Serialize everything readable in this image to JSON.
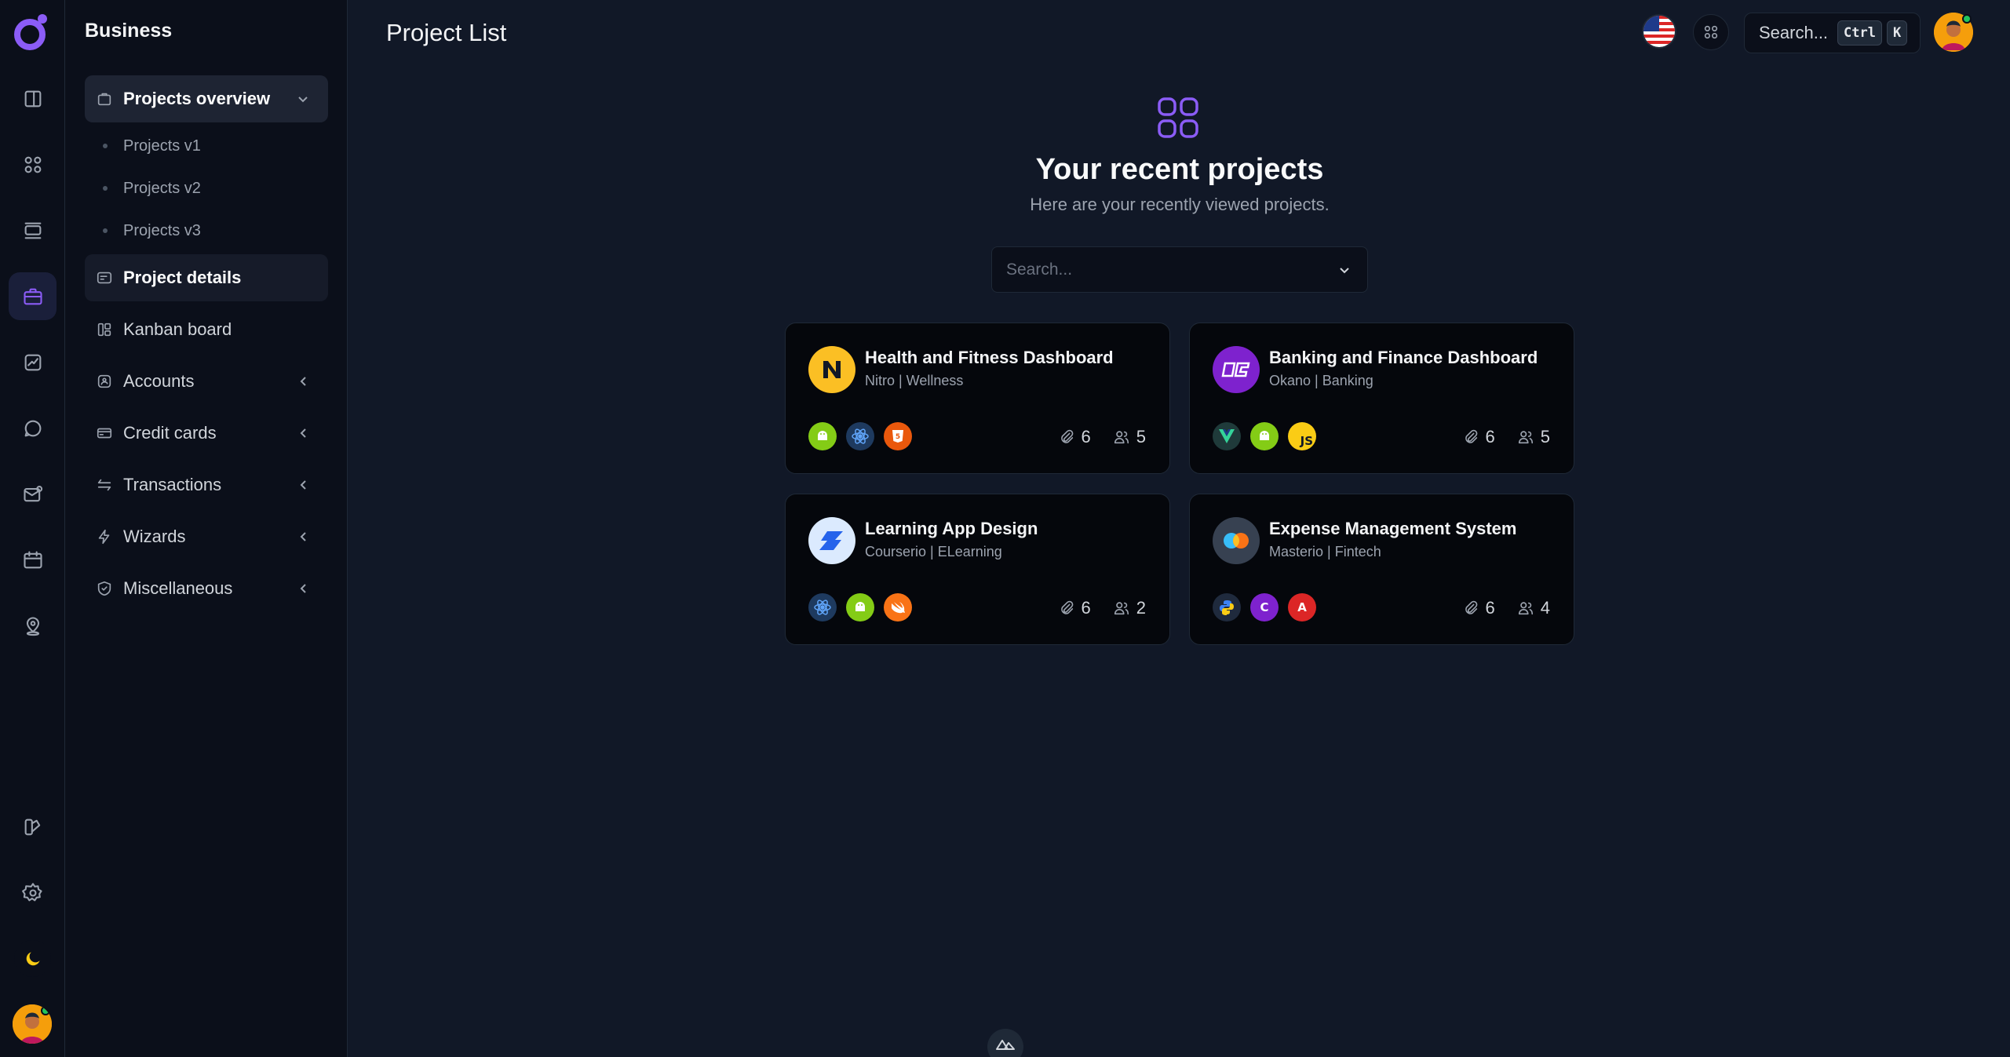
{
  "sidebar": {
    "brand": "Business",
    "items": [
      {
        "label": "Projects overview",
        "icon": "briefcase-bag-icon",
        "state": "open"
      },
      {
        "label": "Project details",
        "icon": "card-icon",
        "state": "active"
      },
      {
        "label": "Kanban board",
        "icon": "kanban-icon"
      },
      {
        "label": "Accounts",
        "icon": "accounts-icon"
      },
      {
        "label": "Credit cards",
        "icon": "credit-card-icon"
      },
      {
        "label": "Transactions",
        "icon": "arrows-icon"
      },
      {
        "label": "Wizards",
        "icon": "bolt-icon"
      },
      {
        "label": "Miscellaneous",
        "icon": "shield-icon"
      }
    ],
    "subitems": [
      "Projects v1",
      "Projects v2",
      "Projects v3"
    ]
  },
  "rail": {
    "icons": [
      "sidebar-toggle-icon",
      "grid-icon",
      "layers-icon",
      "briefcase-icon",
      "chart-icon",
      "chat-icon",
      "mail-icon",
      "calendar-icon",
      "map-pin-icon",
      "palette-icon",
      "settings-icon",
      "moon-icon"
    ],
    "active": "briefcase-icon"
  },
  "header": {
    "title": "Project List",
    "search_placeholder": "Search...",
    "shortcut_keys": [
      "Ctrl",
      "K"
    ]
  },
  "main": {
    "title": "Your recent projects",
    "subtitle": "Here are your recently viewed projects.",
    "search_placeholder": "Search...",
    "accent_color": "#8b5cf6"
  },
  "projects": [
    {
      "name": "Health and Fitness Dashboard",
      "meta": "Nitro | Wellness",
      "techs": [
        "android",
        "react",
        "html5"
      ],
      "files": "6",
      "members": "5"
    },
    {
      "name": "Banking and Finance Dashboard",
      "meta": "Okano | Banking",
      "techs": [
        "vue",
        "android",
        "js"
      ],
      "files": "6",
      "members": "5"
    },
    {
      "name": "Learning App Design",
      "meta": "Courserio | ELearning",
      "techs": [
        "react",
        "android",
        "swift"
      ],
      "files": "6",
      "members": "2"
    },
    {
      "name": "Expense Management System",
      "meta": "Masterio | Fintech",
      "techs": [
        "python",
        "csharp",
        "angular"
      ],
      "files": "6",
      "members": "4"
    }
  ],
  "tech_labels": {
    "js": "JS",
    "csharp": "C",
    "angular": "A"
  }
}
